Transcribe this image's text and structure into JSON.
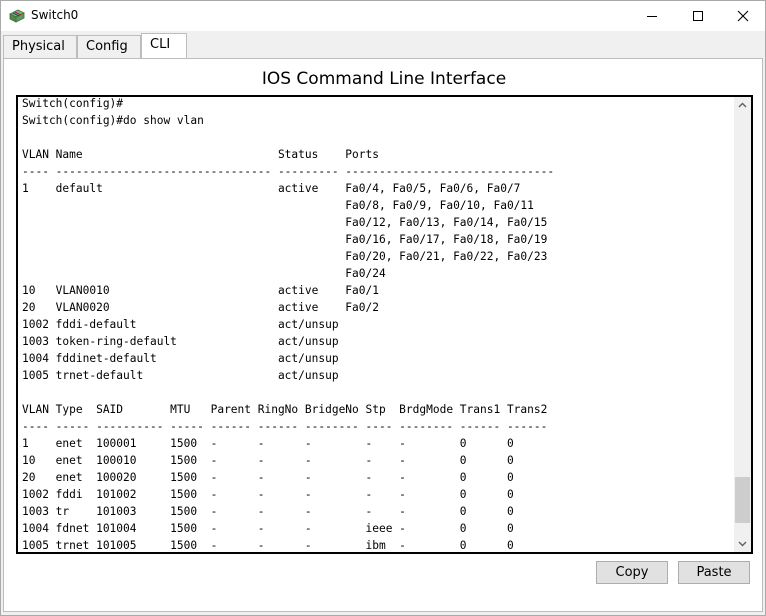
{
  "window": {
    "title": "Switch0",
    "icon": "switch-icon"
  },
  "tabs": [
    {
      "label": "Physical"
    },
    {
      "label": "Config"
    },
    {
      "label": "CLI",
      "active": true
    }
  ],
  "cli": {
    "heading": "IOS Command Line Interface",
    "lines": [
      "Switch(config)#",
      "Switch(config)#do show vlan",
      "",
      "VLAN Name                             Status    Ports",
      "---- -------------------------------- --------- -------------------------------",
      "1    default                          active    Fa0/4, Fa0/5, Fa0/6, Fa0/7",
      "                                                Fa0/8, Fa0/9, Fa0/10, Fa0/11",
      "                                                Fa0/12, Fa0/13, Fa0/14, Fa0/15",
      "                                                Fa0/16, Fa0/17, Fa0/18, Fa0/19",
      "                                                Fa0/20, Fa0/21, Fa0/22, Fa0/23",
      "                                                Fa0/24",
      "10   VLAN0010                         active    Fa0/1",
      "20   VLAN0020                         active    Fa0/2",
      "1002 fddi-default                     act/unsup",
      "1003 token-ring-default               act/unsup",
      "1004 fddinet-default                  act/unsup",
      "1005 trnet-default                    act/unsup",
      "",
      "VLAN Type  SAID       MTU   Parent RingNo BridgeNo Stp  BrdgMode Trans1 Trans2",
      "---- ----- ---------- ----- ------ ------ -------- ---- -------- ------ ------",
      "1    enet  100001     1500  -      -      -        -    -        0      0",
      "10   enet  100010     1500  -      -      -        -    -        0      0",
      "20   enet  100020     1500  -      -      -        -    -        0      0",
      "1002 fddi  101002     1500  -      -      -        -    -        0      0",
      "1003 tr    101003     1500  -      -      -        -    -        0      0",
      "1004 fdnet 101004     1500  -      -      -        ieee -        0      0",
      "1005 trnet 101005     1500  -      -      -        ibm  -        0      0"
    ]
  },
  "buttons": {
    "copy": "Copy",
    "paste": "Paste"
  }
}
